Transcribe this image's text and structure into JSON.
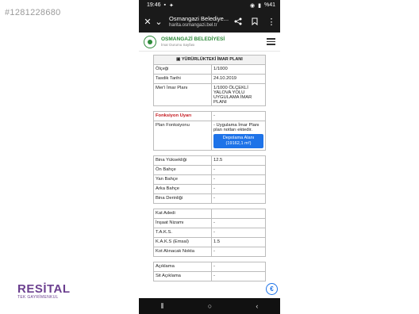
{
  "listing_id": "#1281228680",
  "status": {
    "time": "19:46",
    "battery": "%41"
  },
  "browser": {
    "title": "Osmangazi Belediye...",
    "url": "harita.osmangazi.bel.tr"
  },
  "site": {
    "name": "OSMANGAZİ BELEDİYESİ",
    "subtitle": "İmar Durumu Sayfası"
  },
  "plan": {
    "heading": "YÜRÜRLÜKTEKİ İMAR PLANI",
    "rows": [
      {
        "label": "Ölçeği",
        "value": "1/1000"
      },
      {
        "label": "Tasdik Tarihi",
        "value": "24.10.2019"
      },
      {
        "label": "Mer'i İmar Planı",
        "value": "1/1000 ÖLÇEKLİ YALOVA YOLU UYGULAMA İMAR PLANI"
      }
    ]
  },
  "function": {
    "warning_label": "Fonksiyon Uyarı",
    "warning_value": "-",
    "plan_label": "Plan Fonksiyonu",
    "plan_value": "- Uygulama İmar Planı plan notları ektedir.",
    "area_button": "Depolama Alanı (19162,1 m²)"
  },
  "dimensions": [
    {
      "label": "Bina Yüksekliği",
      "value": "12.5"
    },
    {
      "label": "Ön Bahçe",
      "value": "-"
    },
    {
      "label": "Yan Bahçe",
      "value": "-"
    },
    {
      "label": "Arka Bahçe",
      "value": "-"
    },
    {
      "label": "Bina Derinliği",
      "value": "-"
    }
  ],
  "building": [
    {
      "label": "Kat Adedi",
      "value": ""
    },
    {
      "label": "İnşaat Nizamı",
      "value": "-"
    },
    {
      "label": "T.A.K.S.",
      "value": "-"
    },
    {
      "label": "K.A.K.S (Emsal)",
      "value": "1.5"
    },
    {
      "label": "Kot Alınacak Nokta",
      "value": "-"
    }
  ],
  "notes": [
    {
      "label": "Açıklama",
      "value": "-"
    },
    {
      "label": "Sit Açıklama",
      "value": "-"
    }
  ],
  "brand": {
    "name": "RESİTAL",
    "subtitle": "TEK GAYRİMENKUL"
  },
  "icons": {
    "fab": "accessibility-icon"
  }
}
